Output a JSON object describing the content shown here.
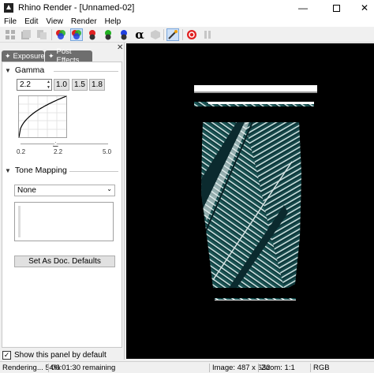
{
  "window": {
    "title": "Rhino Render - [Unnamed-02]",
    "minimize_glyph": "—",
    "close_glyph": "✕"
  },
  "menu": [
    "File",
    "Edit",
    "View",
    "Render",
    "Help"
  ],
  "toolbar": {
    "icons": [
      "grid-icon",
      "copy-icon",
      "duplicate-icon",
      "red-channel-icon",
      "rgb-channel-icon",
      "green-channel-icon",
      "red-ball-icon",
      "green-ball-icon",
      "blue-ball-icon",
      "alpha-icon",
      "material-icon",
      "wand-icon",
      "stop-icon",
      "pause-icon"
    ],
    "alpha_glyph": "α"
  },
  "panel": {
    "close_glyph": "✕",
    "tabs": [
      {
        "label": "Exposure"
      },
      {
        "label": "Post Effects"
      }
    ],
    "gamma": {
      "header": "Gamma",
      "value": "2.2",
      "presets": [
        "1.0",
        "1.5",
        "1.8"
      ],
      "slider_ticks": [
        "0.2",
        "2.2",
        "5.0"
      ],
      "slider_level": 0.4
    },
    "tone_mapping": {
      "header": "Tone Mapping",
      "selected": "None"
    },
    "set_defaults_label": "Set As Doc. Defaults",
    "show_panel_label": "Show this panel by default",
    "show_panel_checked": true
  },
  "status": {
    "progress": "Rendering... 54%",
    "remaining": "00:01:30 remaining",
    "image_size": "Image: 487 x 632",
    "zoom": "Zoom: 1:1",
    "color_mode": "RGB"
  },
  "colors": {
    "vase_teal": "#1e5c5c",
    "vase_dark": "#0d2f33",
    "fin_highlight": "#d8e4e4"
  }
}
